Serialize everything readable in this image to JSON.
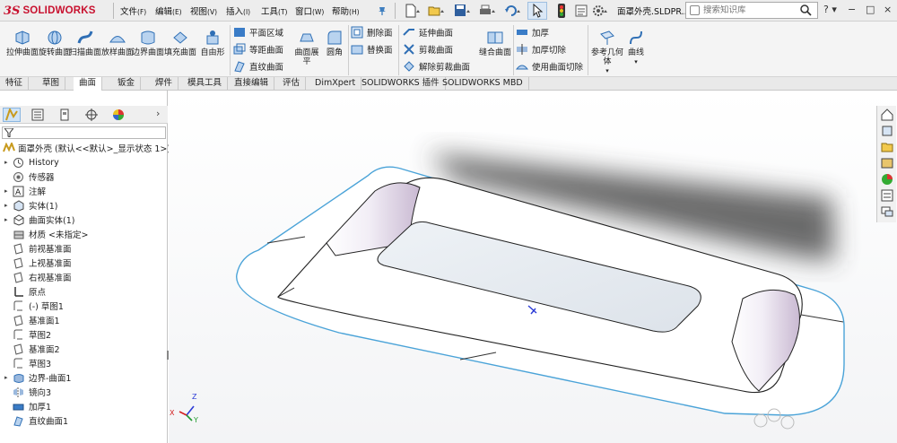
{
  "app": {
    "logo_prefix": "3S",
    "logo": "SOLIDWORKS",
    "menus": [
      {
        "label": "文件",
        "shortcut": "(F)"
      },
      {
        "label": "编辑",
        "shortcut": "(E)"
      },
      {
        "label": "视图",
        "shortcut": "(V)"
      },
      {
        "label": "插入",
        "shortcut": "(I)"
      },
      {
        "label": "工具",
        "shortcut": "(T)"
      },
      {
        "label": "窗口",
        "shortcut": "(W)"
      },
      {
        "label": "帮助",
        "shortcut": "(H)"
      }
    ],
    "document_title": "面罩外壳.SLDPR...",
    "search_placeholder": "搜索知识库",
    "help": "?",
    "window_controls": [
      "−",
      "□",
      "×"
    ]
  },
  "command_manager": {
    "big_buttons": [
      {
        "label": "拉伸曲面",
        "icon": "extruded-surface-icon"
      },
      {
        "label": "旋转曲面",
        "icon": "revolved-surface-icon"
      },
      {
        "label": "扫描曲面",
        "icon": "swept-surface-icon"
      },
      {
        "label": "放样曲面",
        "icon": "lofted-surface-icon"
      },
      {
        "label": "边界曲面",
        "icon": "boundary-surface-icon"
      },
      {
        "label": "填充曲面",
        "icon": "filled-surface-icon"
      },
      {
        "label": "自由形",
        "icon": "freeform-icon"
      }
    ],
    "col2": [
      "平面区域",
      "等距曲面",
      "直纹曲面"
    ],
    "flatten": "曲面展平",
    "fillet": "圆角",
    "col3": [
      "删除面",
      "替换面"
    ],
    "col4": [
      "延伸曲面",
      "剪裁曲面",
      "解除剪裁曲面"
    ],
    "knit": "缝合曲面",
    "col5": [
      "加厚",
      "加厚切除",
      "使用曲面切除"
    ],
    "ref_geometry": "参考几何体",
    "curves": "曲线"
  },
  "tabs": [
    "特征",
    "草图",
    "曲面",
    "钣金",
    "焊件",
    "模具工具",
    "直接编辑",
    "评估",
    "DimXpert",
    "SOLIDWORKS 插件",
    "SOLIDWORKS MBD"
  ],
  "active_tab": "曲面",
  "feature_tree": {
    "root": "面罩外壳 (默认<<默认>_显示状态 1>)",
    "items": [
      {
        "label": "History",
        "expand": true,
        "icon": "history-icon"
      },
      {
        "label": "传感器",
        "expand": false,
        "icon": "sensor-icon"
      },
      {
        "label": "注解",
        "expand": true,
        "icon": "annotation-icon"
      },
      {
        "label": "实体(1)",
        "expand": true,
        "icon": "solid-bodies-icon"
      },
      {
        "label": "曲面实体(1)",
        "expand": true,
        "icon": "surface-bodies-icon"
      },
      {
        "label": "材质 <未指定>",
        "expand": false,
        "icon": "material-icon"
      },
      {
        "label": "前视基准面",
        "expand": false,
        "icon": "plane-icon"
      },
      {
        "label": "上视基准面",
        "expand": false,
        "icon": "plane-icon"
      },
      {
        "label": "右视基准面",
        "expand": false,
        "icon": "plane-icon"
      },
      {
        "label": "原点",
        "expand": false,
        "icon": "origin-icon"
      },
      {
        "label": "(-) 草图1",
        "expand": false,
        "icon": "sketch-icon"
      },
      {
        "label": "基准面1",
        "expand": false,
        "icon": "plane-icon"
      },
      {
        "label": "草图2",
        "expand": false,
        "icon": "sketch-icon"
      },
      {
        "label": "基准面2",
        "expand": false,
        "icon": "plane-icon"
      },
      {
        "label": "草图3",
        "expand": false,
        "icon": "sketch-icon"
      },
      {
        "label": "边界-曲面1",
        "expand": true,
        "icon": "boundary-surface-icon"
      },
      {
        "label": "镜向3",
        "expand": false,
        "icon": "mirror-icon"
      },
      {
        "label": "加厚1",
        "expand": false,
        "icon": "thicken-icon"
      },
      {
        "label": "直纹曲面1",
        "expand": false,
        "icon": "ruled-surface-icon"
      }
    ]
  },
  "triad": {
    "x": "X",
    "y": "Y",
    "z": "Z"
  },
  "colors": {
    "accent": "#2b6cb0",
    "logo": "#c8102e",
    "edge": "#4aa3d8"
  }
}
